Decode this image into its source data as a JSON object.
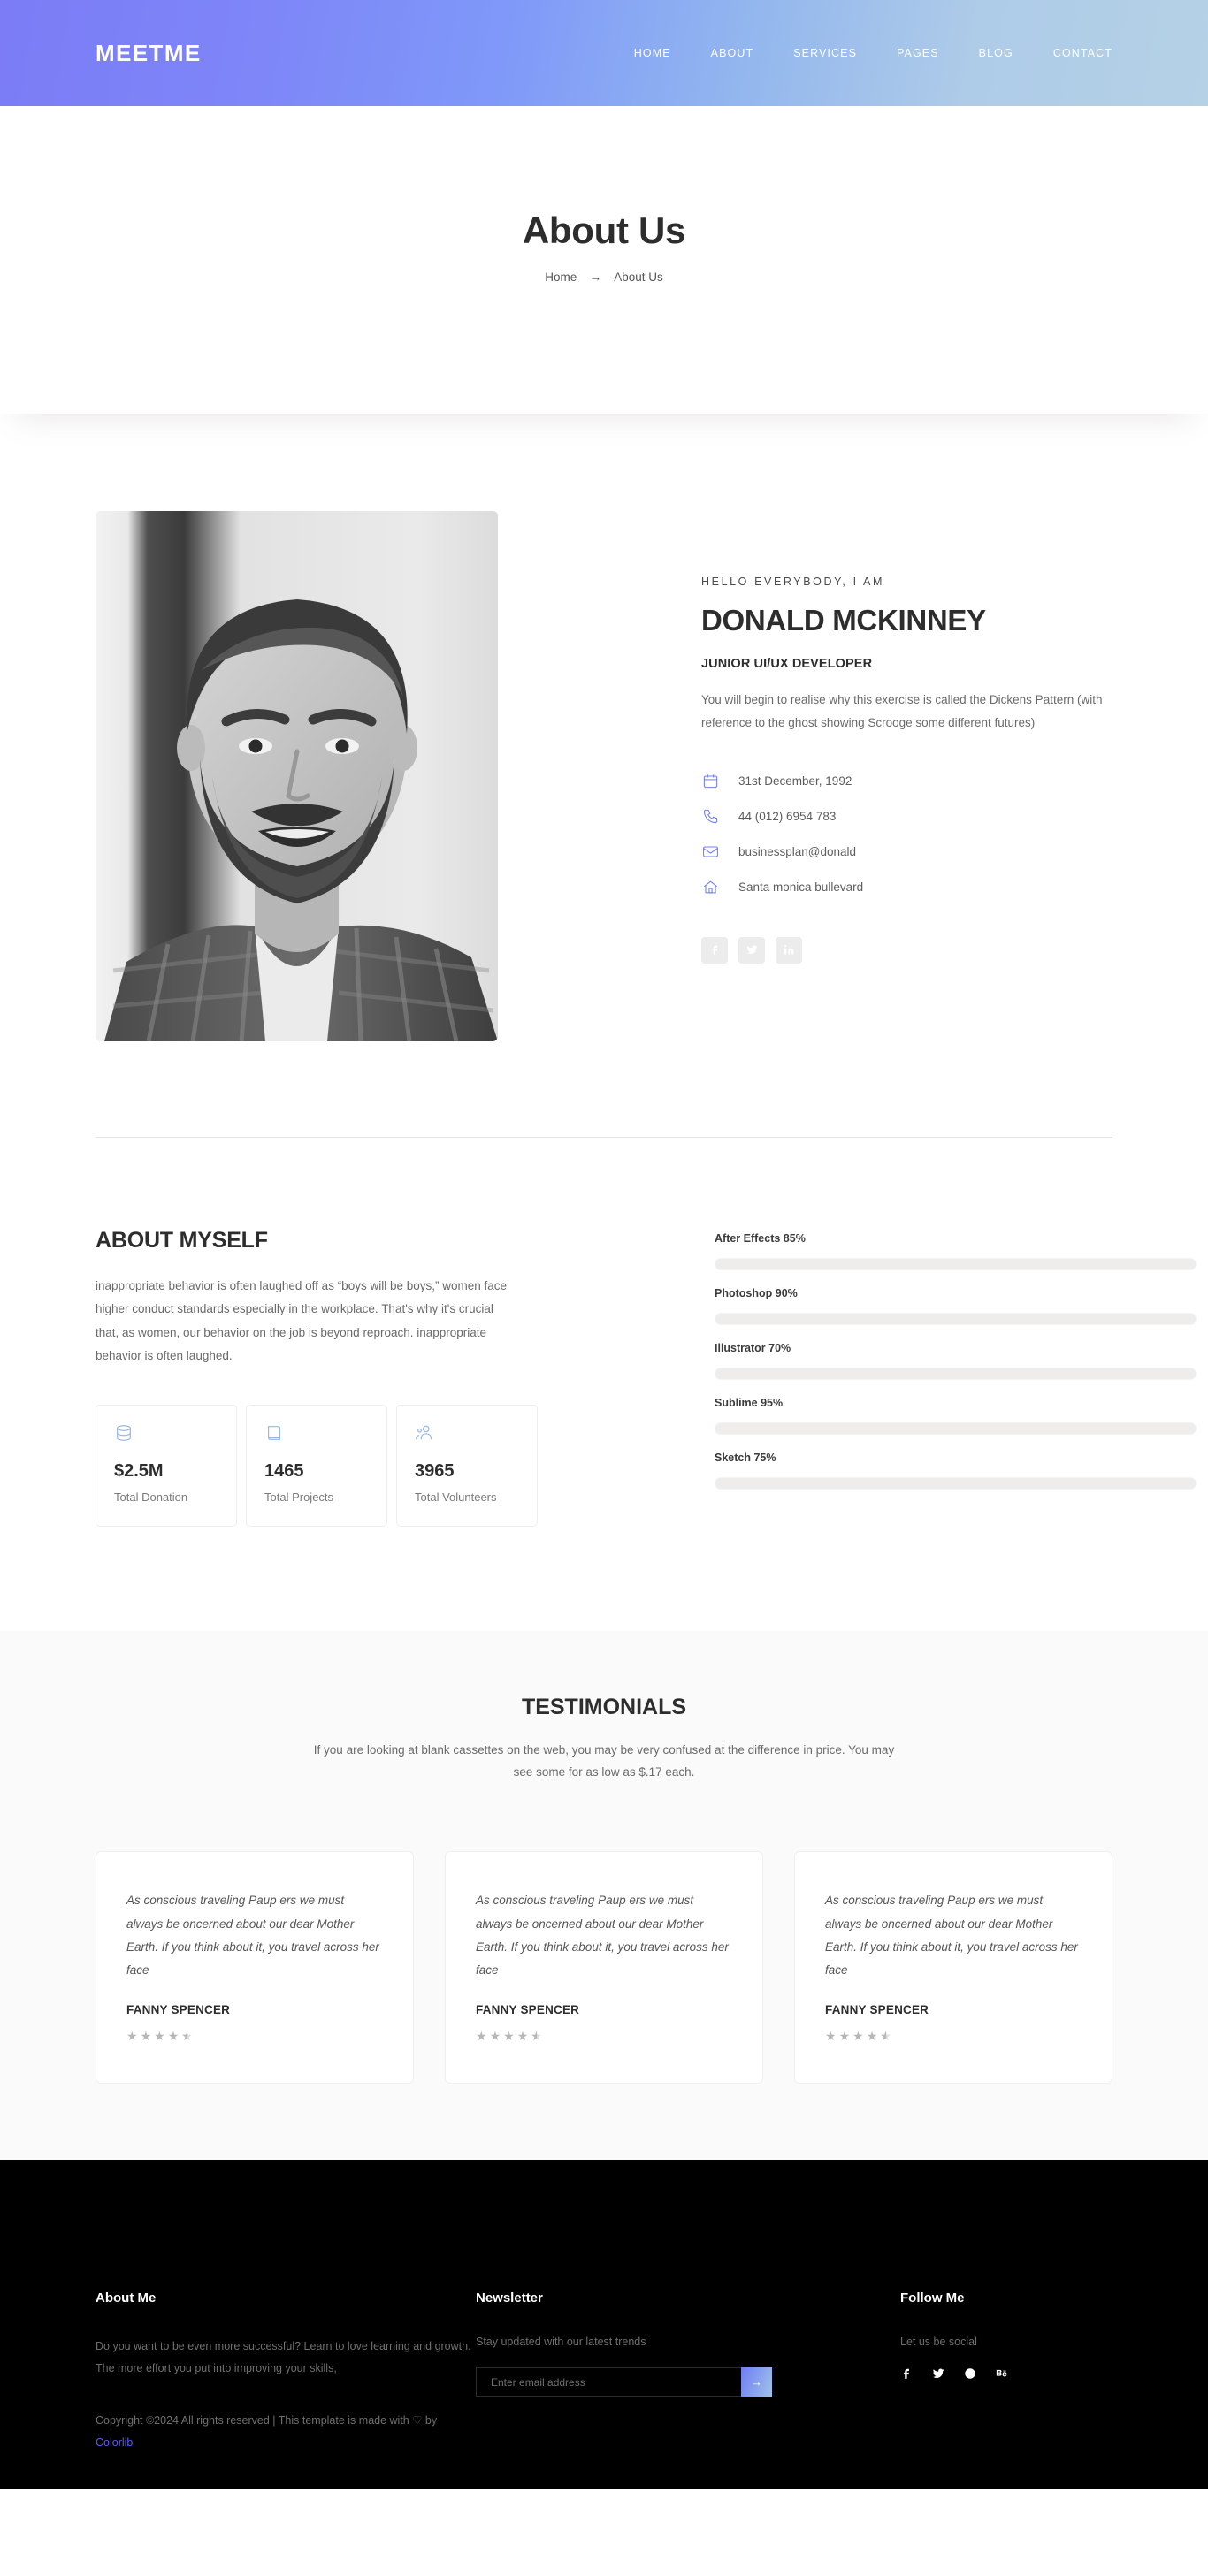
{
  "header": {
    "brand": "MEETME",
    "nav": [
      {
        "label": "HOME"
      },
      {
        "label": "ABOUT"
      },
      {
        "label": "SERVICES"
      },
      {
        "label": "PAGES"
      },
      {
        "label": "BLOG"
      },
      {
        "label": "CONTACT"
      }
    ]
  },
  "hero": {
    "title": "About Us",
    "breadcrumb_home": "Home",
    "breadcrumb_arrow": "→",
    "breadcrumb_current": "About Us"
  },
  "profile": {
    "greeting": "HELLO EVERYBODY, I AM",
    "name": "DONALD MCKINNEY",
    "role": "JUNIOR UI/UX DEVELOPER",
    "description": "You will begin to realise why this exercise is called the Dickens Pattern (with reference to the ghost showing Scrooge some different futures)",
    "contacts": [
      {
        "icon": "calendar-icon",
        "text": "31st December, 1992"
      },
      {
        "icon": "phone-icon",
        "text": "44 (012) 6954 783"
      },
      {
        "icon": "mail-icon",
        "text": "businessplan@donald"
      },
      {
        "icon": "home-icon",
        "text": "Santa monica bullevard"
      }
    ],
    "socials": [
      {
        "icon": "facebook-icon",
        "name": "Facebook"
      },
      {
        "icon": "twitter-icon",
        "name": "Twitter"
      },
      {
        "icon": "linkedin-icon",
        "name": "LinkedIn"
      }
    ]
  },
  "about": {
    "title": "ABOUT MYSELF",
    "text": "inappropriate behavior is often laughed off as “boys will be boys,” women face higher conduct standards especially in the workplace. That's why it's crucial that, as women, our behavior on the job is beyond reproach. inappropriate behavior is often laughed.",
    "stats": [
      {
        "icon": "database-icon",
        "value": "$2.5M",
        "label": "Total Donation"
      },
      {
        "icon": "book-icon",
        "value": "1465",
        "label": "Total Projects"
      },
      {
        "icon": "users-icon",
        "value": "3965",
        "label": "Total Volunteers"
      }
    ],
    "skills": [
      {
        "label": "After Effects 85%",
        "value": 85
      },
      {
        "label": "Photoshop 90%",
        "value": 90
      },
      {
        "label": "Illustrator 70%",
        "value": 70
      },
      {
        "label": "Sublime 95%",
        "value": 95
      },
      {
        "label": "Sketch 75%",
        "value": 75
      }
    ]
  },
  "testimonials": {
    "title": "TESTIMONIALS",
    "subtitle": "If you are looking at blank cassettes on the web, you may be very confused at the difference in price. You may see some for as low as $.17 each.",
    "cards": [
      {
        "quote": "As conscious traveling Paup ers we must always be oncerned about our dear Mother Earth. If you think about it, you travel across her face",
        "name": "FANNY SPENCER",
        "rating": "4.5"
      },
      {
        "quote": "As conscious traveling Paup ers we must always be oncerned about our dear Mother Earth. If you think about it, you travel across her face",
        "name": "FANNY SPENCER",
        "rating": "4.5"
      },
      {
        "quote": "As conscious traveling Paup ers we must always be oncerned about our dear Mother Earth. If you think about it, you travel across her face",
        "name": "FANNY SPENCER",
        "rating": "4.5"
      }
    ]
  },
  "footer": {
    "about_title": "About Me",
    "about_text": "Do you want to be even more successful? Learn to love learning and growth. The more effort you put into improving your skills,",
    "copyright_pre": "Copyright ©2024 All rights reserved | This template is made with ",
    "copyright_heart": "♡",
    "copyright_by": " by ",
    "copyright_link": "Colorlib",
    "newsletter_title": "Newsletter",
    "newsletter_sub": "Stay updated with our latest trends",
    "newsletter_placeholder": "Enter email address",
    "newsletter_value": "",
    "newsletter_submit": "→",
    "follow_title": "Follow Me",
    "follow_sub": "Let us be social",
    "follow_socials": [
      {
        "icon": "facebook-icon",
        "name": "Facebook"
      },
      {
        "icon": "twitter-icon",
        "name": "Twitter"
      },
      {
        "icon": "dribbble-icon",
        "name": "Dribbble"
      },
      {
        "icon": "behance-icon",
        "name": "Behance"
      }
    ]
  },
  "colors": {
    "accent": "#6f7df5",
    "header_gradient_start": "#7b7cf6",
    "header_gradient_end": "#b4d1e6",
    "footer_bg": "#000000",
    "link": "#5b5bf0"
  }
}
